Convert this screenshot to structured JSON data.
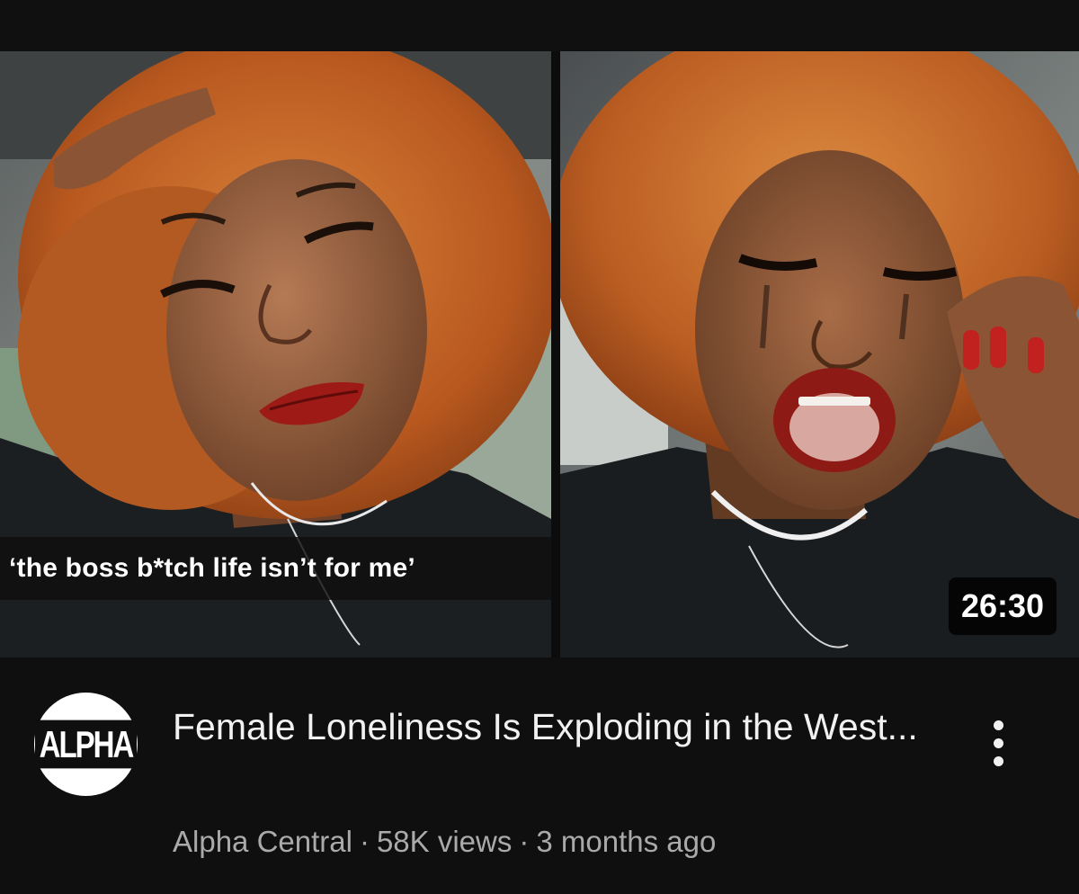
{
  "video": {
    "caption_overlay": "‘the boss b*tch life isn’t for me’",
    "duration": "26:30",
    "title": "Female Loneliness Is Exploding in the West...",
    "channel": "Alpha Central",
    "views": "58K views",
    "age": "3 months ago",
    "channel_logo_text": "ALPHA",
    "more_icon": "more-vert-icon",
    "separator": "·"
  },
  "colors": {
    "background": "#0f0f0f",
    "title": "#f1f1f1",
    "secondary_text": "#aaaaaa",
    "hair": "#c7692a",
    "lips": "#9e1a17"
  }
}
